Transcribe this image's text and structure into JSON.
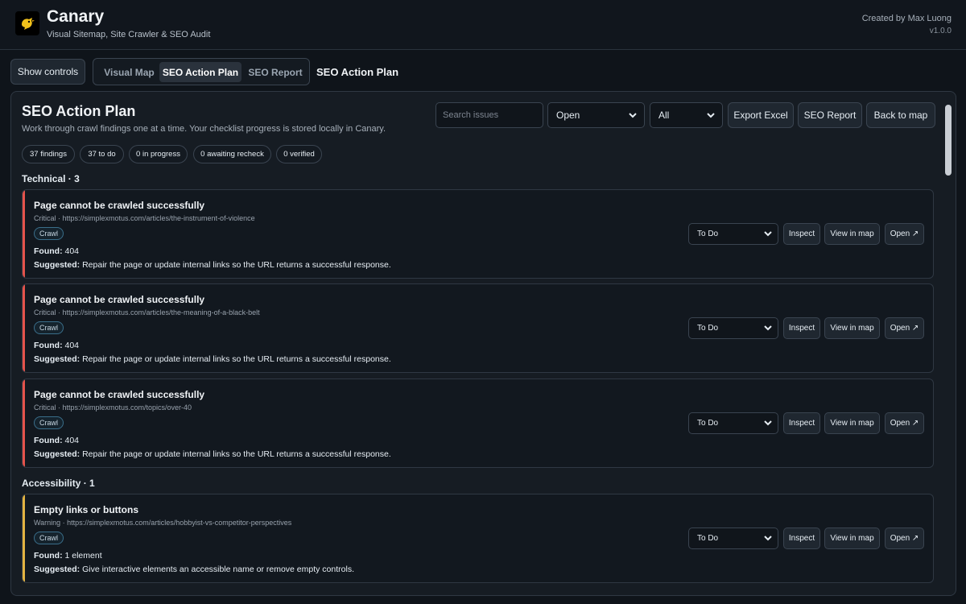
{
  "header": {
    "title": "Canary",
    "subtitle": "Visual Sitemap, Site Crawler & SEO Audit",
    "credit": "Created by Max Luong",
    "version": "v1.0.0"
  },
  "nav": {
    "show_controls": "Show controls",
    "tabs": [
      {
        "label": "Visual Map"
      },
      {
        "label": "SEO Action Plan"
      },
      {
        "label": "SEO Report"
      }
    ],
    "current_view": "SEO Action Plan"
  },
  "panel": {
    "title": "SEO Action Plan",
    "description": "Work through crawl findings one at a time. Your checklist progress is stored locally in Canary.",
    "search_placeholder": "Search issues",
    "status_filter": "Open",
    "category_filter": "All",
    "export_label": "Export Excel",
    "report_label": "SEO Report",
    "back_label": "Back to map",
    "pills": [
      "37 findings",
      "37 to do",
      "0 in progress",
      "0 awaiting recheck",
      "0 verified"
    ]
  },
  "sections": [
    {
      "heading": "Technical · 3"
    },
    {
      "heading": "Accessibility · 1"
    }
  ],
  "labels": {
    "found": "Found:",
    "suggested": "Suggested:",
    "inspect": "Inspect",
    "view_map": "View in map",
    "open": "Open ↗"
  },
  "issues": [
    {
      "title": "Page cannot be crawled successfully",
      "meta": "Critical · https://simplexmotus.com/articles/the-instrument-of-violence",
      "tag": "Crawl",
      "found": "404",
      "suggested": "Repair the page or update internal links so the URL returns a successful response.",
      "status": "To Do",
      "severity_color": "#e5534b"
    },
    {
      "title": "Page cannot be crawled successfully",
      "meta": "Critical · https://simplexmotus.com/articles/the-meaning-of-a-black-belt",
      "tag": "Crawl",
      "found": "404",
      "suggested": "Repair the page or update internal links so the URL returns a successful response.",
      "status": "To Do",
      "severity_color": "#e5534b"
    },
    {
      "title": "Page cannot be crawled successfully",
      "meta": "Critical · https://simplexmotus.com/topics/over-40",
      "tag": "Crawl",
      "found": "404",
      "suggested": "Repair the page or update internal links so the URL returns a successful response.",
      "status": "To Do",
      "severity_color": "#e5534b"
    },
    {
      "title": "Empty links or buttons",
      "meta": "Warning · https://simplexmotus.com/articles/hobbyist-vs-competitor-perspectives",
      "tag": "Crawl",
      "found": "1 element",
      "suggested": "Give interactive elements an accessible name or remove empty controls.",
      "status": "To Do",
      "severity_color": "#e3b341"
    }
  ]
}
